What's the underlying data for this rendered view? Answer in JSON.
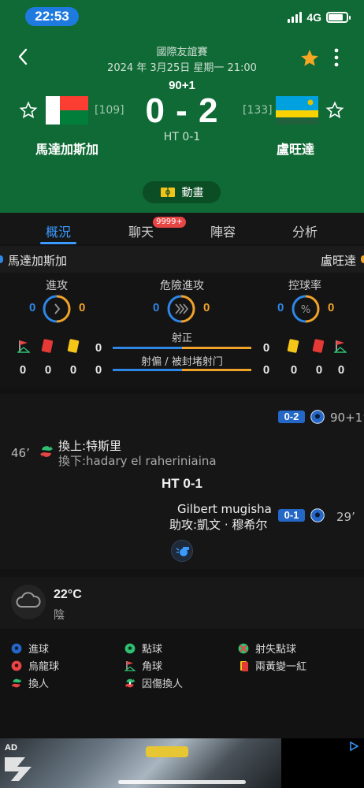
{
  "status_bar": {
    "time": "22:53",
    "network": "4G"
  },
  "match": {
    "competition": "國際友誼賽",
    "datetime": "2024 年 3月25日 星期一 21:00",
    "minute": "90+1",
    "score": "0 - 2",
    "half_time": "HT 0-1",
    "home": {
      "name": "馬達加斯加",
      "rank": "[109]"
    },
    "away": {
      "name": "盧旺達",
      "rank": "[133]"
    },
    "animation_label": "動畫"
  },
  "tabs": [
    {
      "label": "概況",
      "active": true
    },
    {
      "label": "聊天",
      "badge": "9999+"
    },
    {
      "label": "陣容"
    },
    {
      "label": "分析"
    }
  ],
  "team_labels": {
    "home": "馬達加斯加",
    "away": "盧旺達"
  },
  "stats": {
    "attack": {
      "label": "進攻",
      "home": "0",
      "away": "0"
    },
    "dangerous_attack": {
      "label": "危險進攻",
      "home": "0",
      "away": "0"
    },
    "possession": {
      "label": "控球率",
      "home": "0",
      "away": "0",
      "icon_text": "%"
    },
    "shots_on_target": {
      "label": "射正",
      "home": "0",
      "away": "0"
    },
    "shots_off_blocked": {
      "label": "射偏 / 被封堵射门",
      "home": "0",
      "away": "0"
    },
    "home_row1": [
      "0"
    ],
    "home_row2": [
      "0",
      "0",
      "0",
      "0"
    ],
    "away_row1": [
      "0"
    ],
    "away_row2": [
      "0",
      "0",
      "0",
      "0"
    ]
  },
  "timeline": {
    "events": [
      {
        "side": "away",
        "type": "goal",
        "score": "0-2",
        "minute": "90+1’"
      },
      {
        "side": "home",
        "type": "substitution",
        "minute": "46’",
        "in": "換上:特斯里",
        "out": "換下:hadary el raheriniaina"
      },
      {
        "side": "away",
        "type": "goal",
        "score": "0-1",
        "minute": "29’",
        "player": "Gilbert mugisha",
        "assist": "助攻:凱文 · 穆希尔"
      }
    ],
    "ht_label": "HT 0-1"
  },
  "weather": {
    "temp": "22°C",
    "condition": "陰"
  },
  "legend": [
    {
      "label": "進球",
      "icon": "goal-icon"
    },
    {
      "label": "點球",
      "icon": "penalty-icon"
    },
    {
      "label": "射失點球",
      "icon": "missed-penalty-icon"
    },
    {
      "label": "烏龍球",
      "icon": "own-goal-icon"
    },
    {
      "label": "角球",
      "icon": "corner-icon"
    },
    {
      "label": "兩黃變一紅",
      "icon": "second-yellow-icon"
    },
    {
      "label": "換人",
      "icon": "substitution-icon"
    },
    {
      "label": "因傷換人",
      "icon": "injury-sub-icon"
    }
  ],
  "ad": {
    "label": "AD"
  },
  "colors": {
    "header_green": "#0f6a35",
    "accent_blue": "#3a9bff",
    "home_blue": "#2e86e6",
    "away_orange": "#f0a32b"
  }
}
